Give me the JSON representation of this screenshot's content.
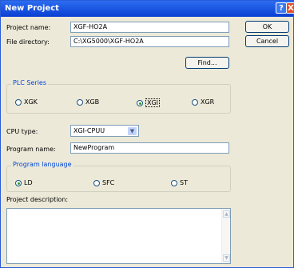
{
  "window": {
    "title": "New Project",
    "help_label": "?",
    "close_label": "X"
  },
  "project_name": {
    "label": "Project name:",
    "value": "XGF-HO2A"
  },
  "file_directory": {
    "label": "File directory:",
    "value": "C:\\XG5000\\XGF-HO2A"
  },
  "buttons": {
    "ok": "OK",
    "cancel": "Cancel",
    "find": "Find..."
  },
  "plc_series": {
    "legend": "PLC Series",
    "options": [
      {
        "label": "XGK",
        "selected": false
      },
      {
        "label": "XGB",
        "selected": false
      },
      {
        "label": "XGI",
        "selected": true
      },
      {
        "label": "XGR",
        "selected": false
      }
    ]
  },
  "cpu_type": {
    "label": "CPU type:",
    "value": "XGI-CPUU"
  },
  "program_name": {
    "label": "Program name:",
    "value": "NewProgram"
  },
  "program_language": {
    "legend": "Program language",
    "options": [
      {
        "label": "LD",
        "selected": true
      },
      {
        "label": "SFC",
        "selected": false
      },
      {
        "label": "ST",
        "selected": false
      }
    ]
  },
  "project_description": {
    "label": "Project description:",
    "value": ""
  }
}
